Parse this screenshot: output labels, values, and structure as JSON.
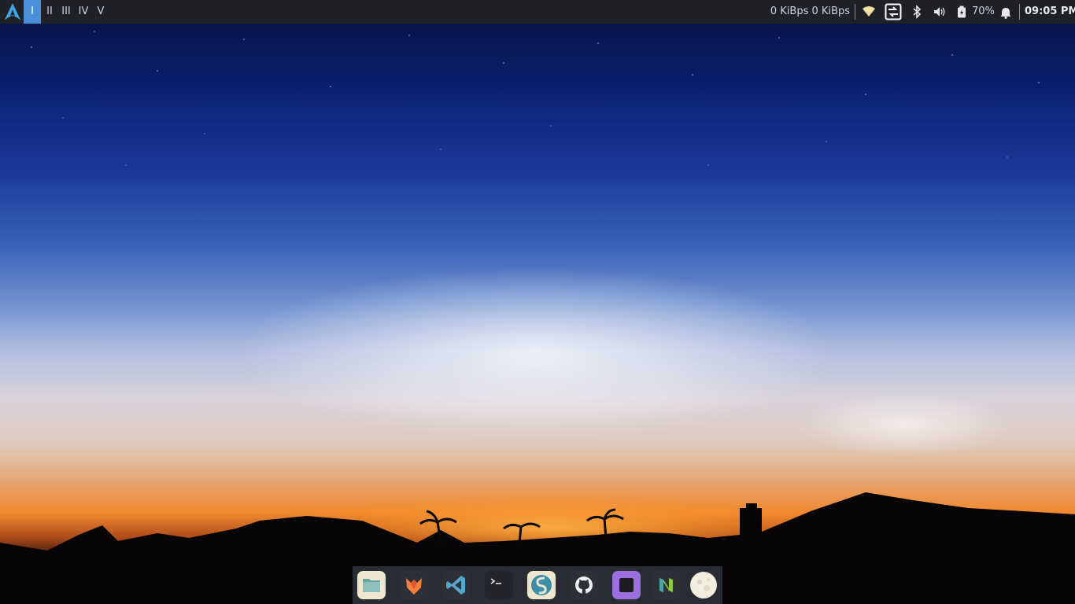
{
  "topbar": {
    "logo_icon": "arch-linux-logo-icon",
    "workspaces": [
      {
        "label": "I",
        "active": true
      },
      {
        "label": "II",
        "active": false
      },
      {
        "label": "III",
        "active": false
      },
      {
        "label": "IV",
        "active": false
      },
      {
        "label": "V",
        "active": false
      }
    ],
    "network_speed": "0 KiBps 0 KiBps",
    "tray": {
      "icons": [
        "wifi-icon",
        "display-switch-icon",
        "bluetooth-icon",
        "volume-icon",
        "battery-icon",
        "notification-bell-icon"
      ],
      "battery_percent": "70%"
    },
    "clock": "09:05 PM"
  },
  "dock": {
    "apps": [
      {
        "name": "files",
        "icon": "file-manager-icon"
      },
      {
        "name": "firefox",
        "icon": "firefox-icon"
      },
      {
        "name": "vscode",
        "icon": "vscode-icon"
      },
      {
        "name": "terminal",
        "icon": "terminal-icon"
      },
      {
        "name": "simplenote",
        "icon": "simplenote-icon"
      },
      {
        "name": "github",
        "icon": "github-icon"
      },
      {
        "name": "app-square",
        "icon": "purple-square-app-icon"
      },
      {
        "name": "neovim",
        "icon": "neovim-icon"
      },
      {
        "name": "moon",
        "icon": "moon-app-icon"
      }
    ]
  },
  "colors": {
    "bar_background": "#1f2127",
    "active_workspace": "#4a90d9",
    "dock_background": "#2a2c33"
  }
}
